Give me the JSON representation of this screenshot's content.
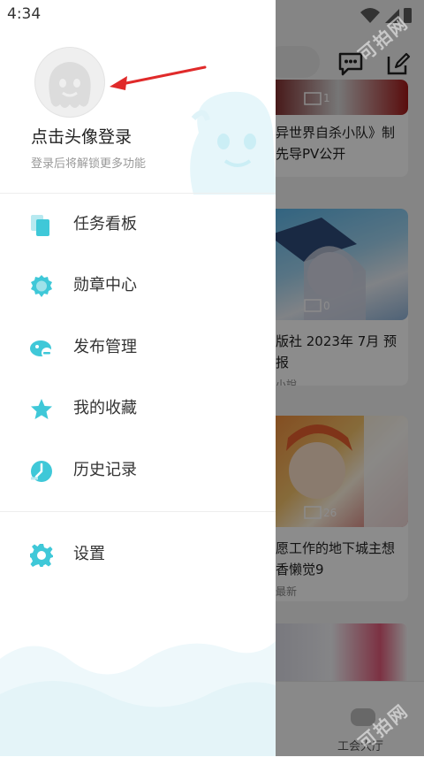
{
  "status_bar": {
    "time": "4:34"
  },
  "profile": {
    "login_title": "点击头像登录",
    "login_subtitle": "登录后将解锁更多功能"
  },
  "menu": [
    {
      "label": "任务看板",
      "icon": "task-board-icon"
    },
    {
      "label": "勋章中心",
      "icon": "medal-icon"
    },
    {
      "label": "发布管理",
      "icon": "publish-icon"
    },
    {
      "label": "我的收藏",
      "icon": "star-icon"
    },
    {
      "label": "历史记录",
      "icon": "history-icon"
    },
    {
      "label": "设置",
      "icon": "gear-icon"
    }
  ],
  "background_feed": {
    "cards": [
      {
        "count": "1",
        "title_line1": "异世界自杀小队》制",
        "title_line2": "先导PV公开",
        "subtitle": ""
      },
      {
        "count": "0",
        "title_line1": "版社 2023年 7月 预",
        "title_line2": "报",
        "subtitle": "小說"
      },
      {
        "count": "26",
        "title_line1": "愿工作的地下城主想",
        "title_line2": "香懒觉9",
        "subtitle": "最新"
      }
    ],
    "bottom_tab": "工会大厅"
  },
  "watermark": "可拍网",
  "colors": {
    "accent": "#3fc8d8",
    "text": "#333333",
    "muted": "#999999",
    "arrow": "#e02a2a"
  }
}
